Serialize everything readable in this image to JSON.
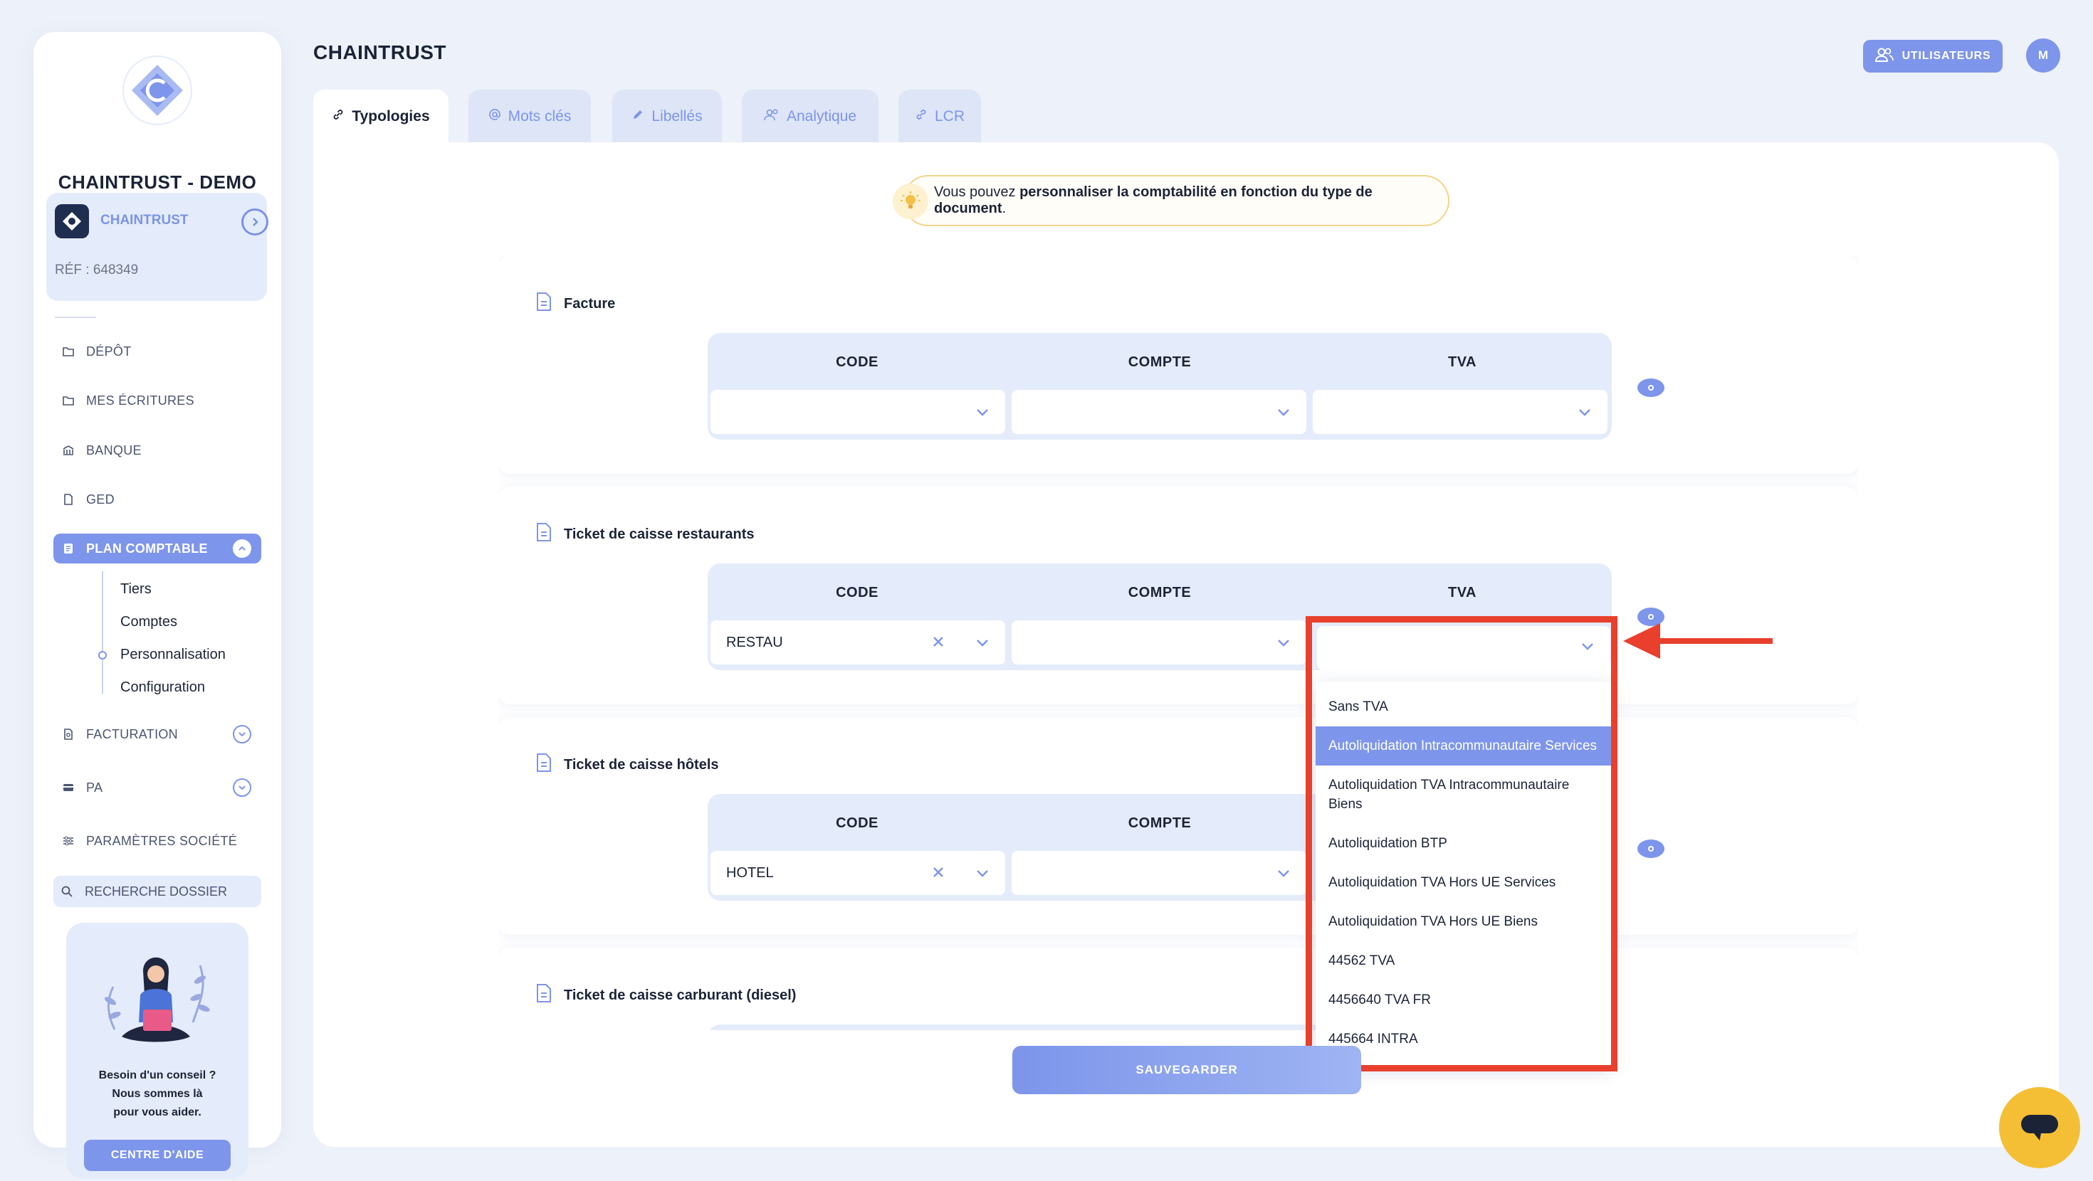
{
  "sidebar": {
    "company_title": "CHAINTRUST - DEMO",
    "client": {
      "name": "CHAINTRUST",
      "ref": "RÉF : 648349"
    },
    "nav": {
      "depot": "DÉPÔT",
      "ecritures": "MES ÉCRITURES",
      "banque": "BANQUE",
      "ged": "GED",
      "plan": "PLAN COMPTABLE",
      "facturation": "FACTURATION",
      "pa": "PA",
      "parametres": "PARAMÈTRES SOCIÉTÉ"
    },
    "subnav": [
      "Tiers",
      "Comptes",
      "Personnalisation",
      "Configuration"
    ],
    "search_label": "RECHERCHE DOSSIER",
    "help": {
      "line1": "Besoin d'un conseil ?",
      "line2": "Nous sommes là",
      "line3": "pour vous aider.",
      "button": "CENTRE D'AIDE"
    }
  },
  "header": {
    "title": "CHAINTRUST",
    "users_button": "UTILISATEURS",
    "avatar_initial": "M"
  },
  "tabs": [
    "Typologies",
    "Mots clés",
    "Libellés",
    "Analytique",
    "LCR"
  ],
  "tip": {
    "prefix": "Vous pouvez ",
    "bold": "personnaliser la comptabilité en fonction du type de document",
    "suffix": "."
  },
  "columns": {
    "code": "CODE",
    "compte": "COMPTE",
    "tva": "TVA"
  },
  "types": [
    {
      "name": "Facture",
      "code": ""
    },
    {
      "name": "Ticket de caisse restaurants",
      "code": "RESTAU"
    },
    {
      "name": "Ticket de caisse hôtels",
      "code": "HOTEL"
    },
    {
      "name": "Ticket de caisse carburant (diesel)",
      "code": ""
    }
  ],
  "tva_options": [
    "Sans TVA",
    "Autoliquidation Intracommunautaire Services",
    "Autoliquidation TVA Intracommunautaire Biens",
    "Autoliquidation BTP",
    "Autoliquidation TVA Hors UE Services",
    "Autoliquidation TVA Hors UE Biens",
    "44562 TVA",
    "4456640 TVA FR",
    "445664 INTRA"
  ],
  "tva_selected_index": 1,
  "save_button": "SAUVEGARDER",
  "colors": {
    "accent": "#7d95ea",
    "highlight": "#e8402c",
    "chat": "#f5bf35"
  }
}
